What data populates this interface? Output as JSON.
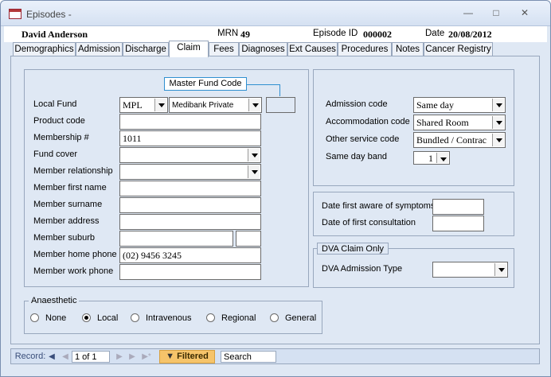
{
  "window": {
    "title": "Episodes -"
  },
  "header": {
    "patient_name": "David Anderson",
    "mrn_label": "MRN",
    "mrn_value": "49",
    "episode_label": "Episode ID",
    "episode_value": "000002",
    "date_label": "Date",
    "date_value": "20/08/2012"
  },
  "tabs": [
    "Demographics",
    "Admission",
    "Discharge",
    "Claim",
    "Fees",
    "Diagnoses",
    "Ext Causes",
    "Procedures",
    "Notes",
    "Cancer Registry"
  ],
  "active_tab": "Claim",
  "fund": {
    "master_fund_code_label": "Master Fund Code",
    "labels": {
      "local_fund": "Local Fund",
      "product_code": "Product code",
      "membership": "Membership #",
      "fund_cover": "Fund cover",
      "member_relationship": "Member relationship",
      "member_first_name": "Member first name",
      "member_surname": "Member surname",
      "member_address": "Member address",
      "member_suburb": "Member suburb",
      "member_home_phone": "Member home phone",
      "member_work_phone": "Member work phone"
    },
    "values": {
      "local_fund_code": "MPL",
      "local_fund_name": "Medibank Private",
      "membership": "1011",
      "member_home_phone": "(02) 9456 3245"
    }
  },
  "admission": {
    "labels": {
      "admission_code": "Admission code",
      "accommodation_code": "Accommodation code",
      "other_service_code": "Other service code",
      "same_day_band": "Same day band"
    },
    "values": {
      "admission_code": "Same day",
      "accommodation_code": "Shared Room",
      "other_service_code": "Bundled / Contrac",
      "same_day_band": "1"
    }
  },
  "symptoms": {
    "first_aware_label": "Date first aware of symptoms",
    "first_consult_label": "Date of first consultation"
  },
  "dva": {
    "group_label": "DVA Claim Only",
    "admission_type_label": "DVA Admission Type"
  },
  "anaesthetic": {
    "group_label": "Anaesthetic",
    "options": [
      "None",
      "Local",
      "Intravenous",
      "Regional",
      "General"
    ],
    "selected": "Local"
  },
  "record_nav": {
    "record_label": "Record:",
    "position": "1 of 1",
    "filter_label": "Filtered",
    "search_placeholder": "Search"
  }
}
